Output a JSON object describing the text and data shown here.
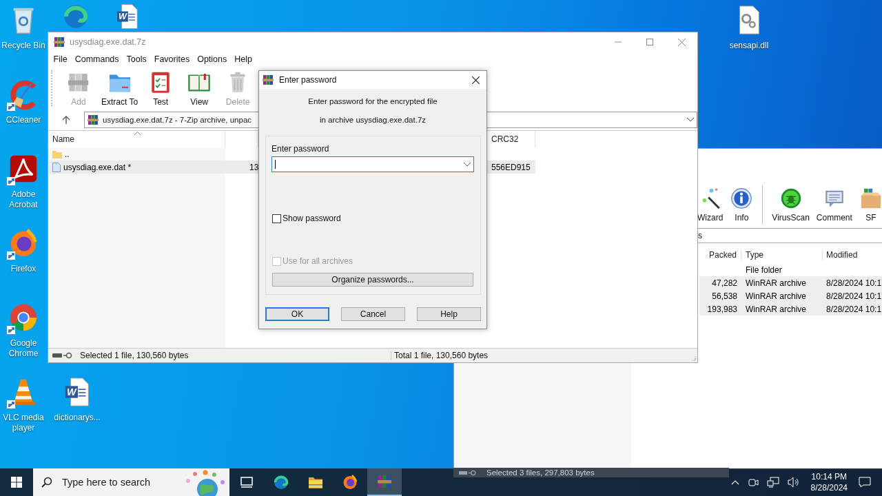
{
  "desktop_icons": [
    {
      "kind": "recycle_bin",
      "label": "Recycle Bin",
      "shortcut": false
    },
    {
      "kind": "edge",
      "shortcut": false
    },
    {
      "kind": "word",
      "glyph": "W",
      "shortcut": false
    },
    {
      "kind": "dll",
      "label": "sensapi.dll",
      "shortcut": false
    },
    {
      "kind": "ccleaner",
      "label": "CCleaner",
      "shortcut": true
    },
    {
      "kind": "acrobat",
      "label": "Adobe Acrobat",
      "shortcut": true
    },
    {
      "kind": "firefox",
      "label": "Firefox",
      "shortcut": true
    },
    {
      "kind": "chrome",
      "label": "Google Chrome",
      "shortcut": true
    },
    {
      "kind": "vlc",
      "label": "VLC media player",
      "shortcut": true
    },
    {
      "kind": "word",
      "glyph": "W",
      "label": "dictionarys...",
      "shortcut": false
    }
  ],
  "back_window": {
    "toolbar": [
      {
        "kind": "wizard",
        "label": "Wizard"
      },
      {
        "kind": "info",
        "label": "Info"
      },
      {
        "kind": "separator"
      },
      {
        "kind": "virusscan",
        "label": "VirusScan"
      },
      {
        "kind": "comment",
        "label": "Comment"
      },
      {
        "kind": "sfx",
        "label": "SF"
      }
    ],
    "address": "s",
    "columns": [
      "Packed",
      "Type",
      "Modified"
    ],
    "rows": [
      {
        "type": "File folder",
        "selected": false
      },
      {
        "packed": "47,282",
        "type": "WinRAR archive",
        "modified": "8/28/2024 10:1",
        "selected": true
      },
      {
        "packed": "56,538",
        "type": "WinRAR archive",
        "modified": "8/28/2024 10:1",
        "selected": true
      },
      {
        "packed": "193,983",
        "type": "WinRAR archive",
        "modified": "8/28/2024 10:1",
        "selected": true
      }
    ],
    "status": "Selected 3 files, 297,803 bytes"
  },
  "main_window": {
    "title": "usysdiag.exe.dat.7z",
    "menu": [
      "File",
      "Commands",
      "Tools",
      "Favorites",
      "Options",
      "Help"
    ],
    "toolbar": [
      {
        "kind": "add",
        "label": "Add",
        "disabled": true
      },
      {
        "kind": "extract",
        "label": "Extract To",
        "disabled": false
      },
      {
        "kind": "test",
        "label": "Test",
        "disabled": false
      },
      {
        "kind": "view",
        "label": "View",
        "disabled": false
      },
      {
        "kind": "delete",
        "label": "Delete",
        "disabled": true
      }
    ],
    "address": "usysdiag.exe.dat.7z - 7-Zip archive, unpac",
    "name_column": {
      "label": "Name",
      "sorted": true
    },
    "crc_column": "CRC32",
    "rows": [
      {
        "kind": "folder",
        "name": "..",
        "selected": false
      },
      {
        "kind": "file",
        "name": "usysdiag.exe.dat *",
        "size": "13",
        "crc": "556ED915",
        "selected": true
      }
    ],
    "status_left": "Selected 1 file, 130,560 bytes",
    "status_right": "Total 1 file, 130,560 bytes"
  },
  "dialog": {
    "title": "Enter password",
    "message": [
      "Enter password for the encrypted file",
      "in archive usysdiag.exe.dat.7z"
    ],
    "field_label": "Enter password",
    "field_focused": true,
    "options": [
      {
        "label": "Show password",
        "checked": false,
        "disabled": false
      },
      {
        "label": "Use for all archives",
        "checked": false,
        "disabled": true
      }
    ],
    "organize_button": "Organize passwords...",
    "buttons": [
      {
        "label": "OK",
        "default": true
      },
      {
        "label": "Cancel",
        "default": false
      },
      {
        "label": "Help",
        "default": false
      }
    ]
  },
  "taskbar": {
    "search_placeholder": "Type here to search",
    "apps": [
      {
        "kind": "task_view",
        "selected": false
      },
      {
        "kind": "edge",
        "selected": false
      },
      {
        "kind": "explorer",
        "selected": false
      },
      {
        "kind": "firefox",
        "selected": false
      },
      {
        "kind": "winrar",
        "selected": true
      }
    ],
    "time": "10:14 PM",
    "date": "8/28/2024"
  }
}
